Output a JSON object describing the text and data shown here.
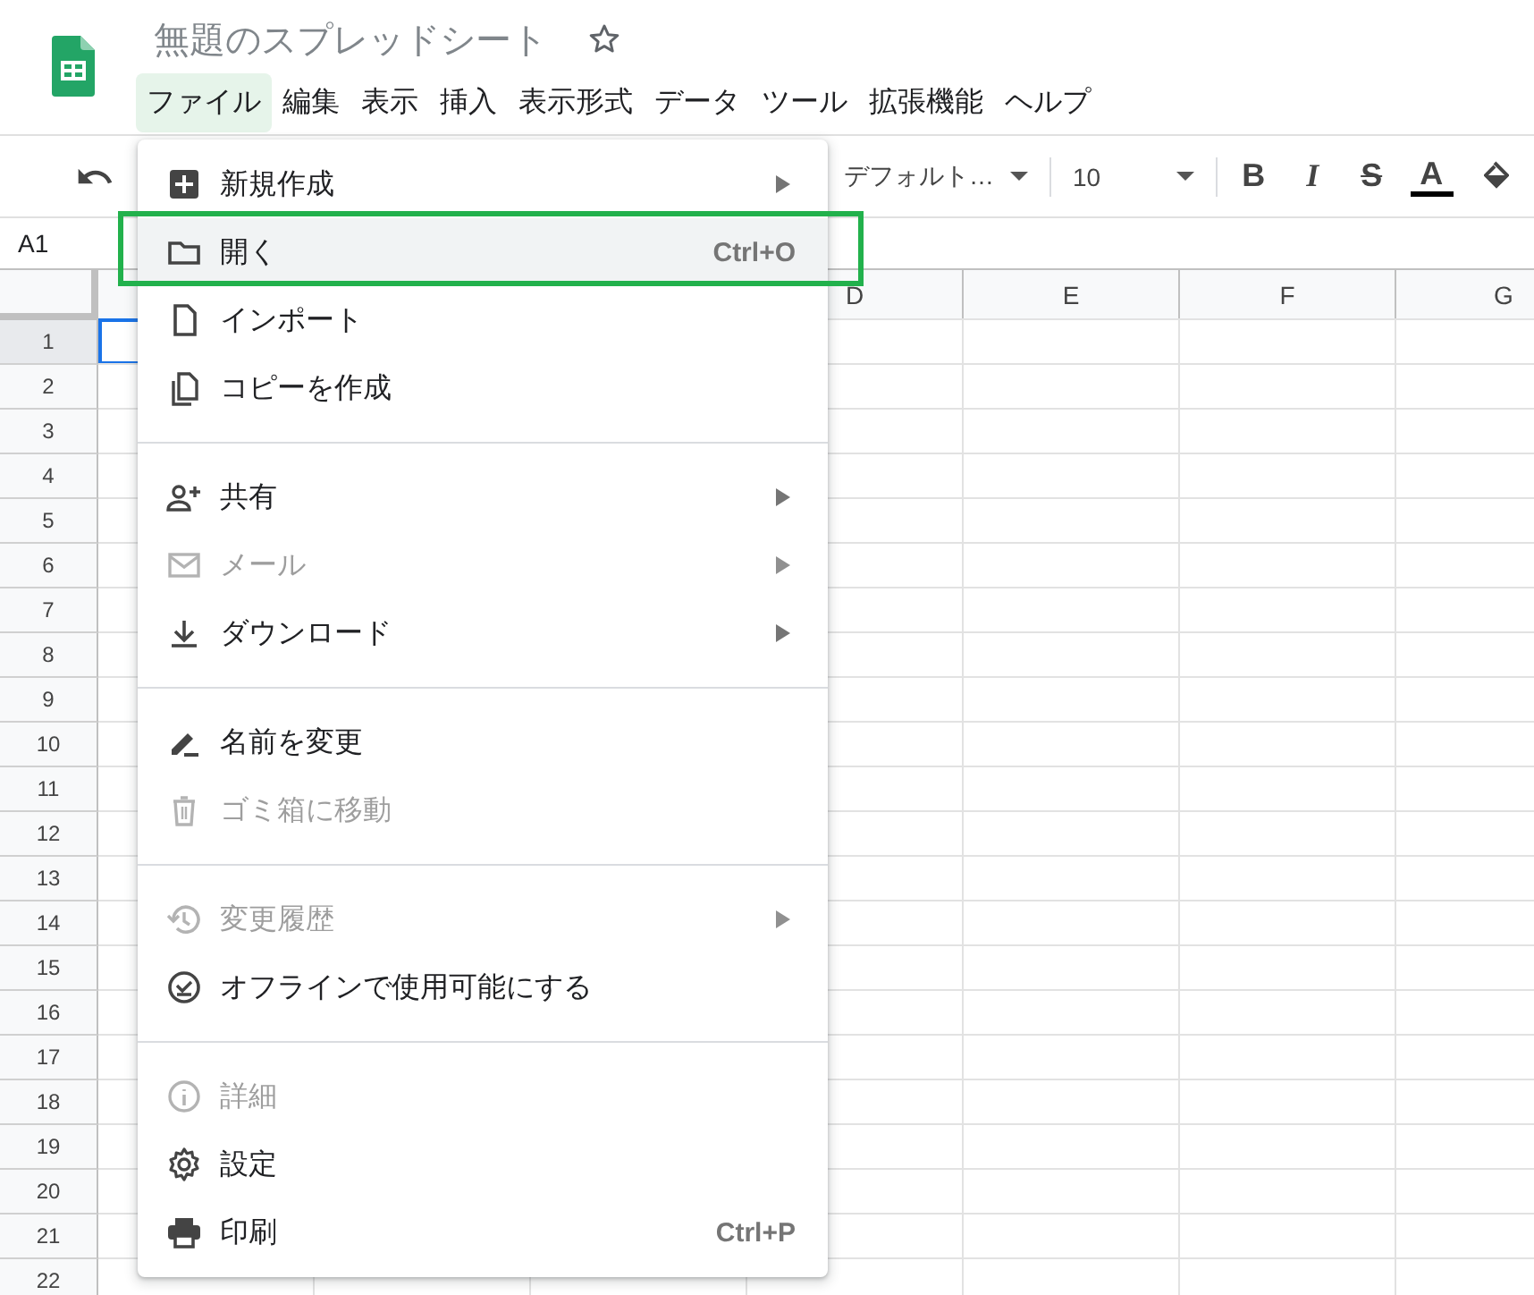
{
  "document": {
    "title": "無題のスプレッドシート"
  },
  "menubar": [
    {
      "label": "ファイル",
      "selected": true
    },
    {
      "label": "編集",
      "selected": false
    },
    {
      "label": "表示",
      "selected": false
    },
    {
      "label": "挿入",
      "selected": false
    },
    {
      "label": "表示形式",
      "selected": false
    },
    {
      "label": "データ",
      "selected": false
    },
    {
      "label": "ツール",
      "selected": false
    },
    {
      "label": "拡張機能",
      "selected": false
    },
    {
      "label": "ヘルプ",
      "selected": false
    }
  ],
  "toolbar": {
    "font": "デフォルト…",
    "font_size": "10",
    "format_buttons": [
      {
        "kind": "bold",
        "label": "B"
      },
      {
        "kind": "italic",
        "label": "I"
      },
      {
        "kind": "strike",
        "label": "S"
      },
      {
        "kind": "color",
        "label": "A"
      }
    ]
  },
  "name_box": "A1",
  "columns": [
    {
      "label": "D"
    },
    {
      "label": "E"
    },
    {
      "label": "F"
    },
    {
      "label": "G"
    }
  ],
  "rows": [
    {
      "label": "1",
      "selected": true
    },
    {
      "label": "2",
      "selected": false
    },
    {
      "label": "3",
      "selected": false
    },
    {
      "label": "4",
      "selected": false
    },
    {
      "label": "5",
      "selected": false
    },
    {
      "label": "6",
      "selected": false
    },
    {
      "label": "7",
      "selected": false
    },
    {
      "label": "8",
      "selected": false
    },
    {
      "label": "9",
      "selected": false
    },
    {
      "label": "10",
      "selected": false
    },
    {
      "label": "11",
      "selected": false
    },
    {
      "label": "12",
      "selected": false
    },
    {
      "label": "13",
      "selected": false
    },
    {
      "label": "14",
      "selected": false
    },
    {
      "label": "15",
      "selected": false
    },
    {
      "label": "16",
      "selected": false
    },
    {
      "label": "17",
      "selected": false
    },
    {
      "label": "18",
      "selected": false
    },
    {
      "label": "19",
      "selected": false
    },
    {
      "label": "20",
      "selected": false
    },
    {
      "label": "21",
      "selected": false
    },
    {
      "label": "22",
      "selected": false
    }
  ],
  "file_menu": [
    {
      "kind": "item",
      "label": "新規作成",
      "submenu": true,
      "disabled": false,
      "highlighted": false
    },
    {
      "kind": "item",
      "label": "開く",
      "shortcut": "Ctrl+O",
      "submenu": false,
      "disabled": false,
      "highlighted": true
    },
    {
      "kind": "item",
      "label": "インポート",
      "submenu": false,
      "disabled": false,
      "highlighted": false
    },
    {
      "kind": "item",
      "label": "コピーを作成",
      "submenu": false,
      "disabled": false,
      "highlighted": false
    },
    {
      "kind": "divider"
    },
    {
      "kind": "item",
      "label": "共有",
      "submenu": true,
      "disabled": false,
      "highlighted": false
    },
    {
      "kind": "item",
      "label": "メール",
      "submenu": true,
      "disabled": true,
      "highlighted": false
    },
    {
      "kind": "item",
      "label": "ダウンロード",
      "submenu": true,
      "disabled": false,
      "highlighted": false
    },
    {
      "kind": "divider"
    },
    {
      "kind": "item",
      "label": "名前を変更",
      "submenu": false,
      "disabled": false,
      "highlighted": false
    },
    {
      "kind": "item",
      "label": "ゴミ箱に移動",
      "submenu": false,
      "disabled": true,
      "highlighted": false
    },
    {
      "kind": "divider"
    },
    {
      "kind": "item",
      "label": "変更履歴",
      "submenu": true,
      "disabled": true,
      "highlighted": false
    },
    {
      "kind": "item",
      "label": "オフラインで使用可能にする",
      "submenu": false,
      "disabled": false,
      "highlighted": false
    },
    {
      "kind": "divider"
    },
    {
      "kind": "item",
      "label": "詳細",
      "submenu": false,
      "disabled": true,
      "highlighted": false
    },
    {
      "kind": "item",
      "label": "設定",
      "submenu": false,
      "disabled": false,
      "highlighted": false
    },
    {
      "kind": "item",
      "label": "印刷",
      "shortcut": "Ctrl+P",
      "submenu": false,
      "disabled": false,
      "highlighted": false
    }
  ]
}
